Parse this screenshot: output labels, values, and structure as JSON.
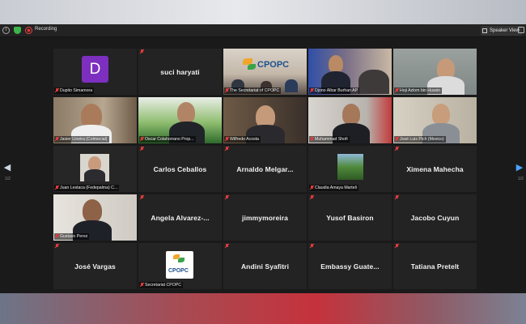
{
  "window": {
    "recording_label": "Recording",
    "speaker_view_label": "Speaker View"
  },
  "nav": {
    "page_left": "1/2",
    "page_right": "1/2"
  },
  "tiles": [
    {
      "name": "Dupito Simamora",
      "avatar_letter": "D",
      "kind": "avatar"
    },
    {
      "name": "suci haryati",
      "kind": "name"
    },
    {
      "name": "The Secretariat of CPOPC",
      "kind": "video",
      "logo_text": "CPOPC"
    },
    {
      "name": "Djono Albar Burhan AP",
      "kind": "video"
    },
    {
      "name": "Hoji Azlom bin Hussin",
      "kind": "video"
    },
    {
      "name": "Javier Lineira (Colmecial)",
      "kind": "video"
    },
    {
      "name": "Oscar Colahorrano Prop...",
      "kind": "video"
    },
    {
      "name": "Wilfredo Acosta",
      "kind": "video"
    },
    {
      "name": "Muhammad Shofi",
      "kind": "video"
    },
    {
      "name": "José Luis Pich (Mexico)",
      "kind": "video"
    },
    {
      "name": "Juan Lestaca (Fedepalma) C...",
      "kind": "video",
      "active": true
    },
    {
      "name": "Carlos Ceballos",
      "kind": "name"
    },
    {
      "name": "Arnaldo  Melgar...",
      "kind": "name"
    },
    {
      "name": "Claudia Amaya Marteli",
      "kind": "video"
    },
    {
      "name": "Ximena Mahecha",
      "kind": "name"
    },
    {
      "name": "Gustavo Perez",
      "kind": "video"
    },
    {
      "name": "Angela  Alvarez-...",
      "kind": "name"
    },
    {
      "name": "jimmymoreira",
      "kind": "name"
    },
    {
      "name": "Yusof Basiron",
      "kind": "name"
    },
    {
      "name": "Jacobo Cuyun",
      "kind": "name"
    },
    {
      "name": "José Vargas",
      "kind": "name"
    },
    {
      "name": "Secretariat CPOPC",
      "kind": "video",
      "logo_text": "CPOPC"
    },
    {
      "name": "Andini Syafitri",
      "kind": "name"
    },
    {
      "name": "Embassy  Guate...",
      "kind": "name"
    },
    {
      "name": "Tatiana Pretelt",
      "kind": "name"
    }
  ],
  "colors": {
    "active_speaker": "#a7c72f",
    "avatar_purple": "#7d2fbf",
    "muted_red": "#e23b3b",
    "next_arrow": "#4aa3ff"
  }
}
